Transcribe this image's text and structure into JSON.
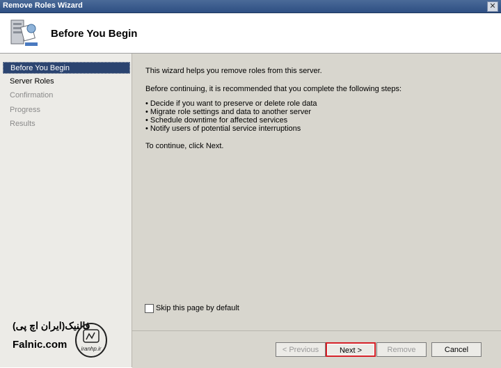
{
  "window": {
    "title": "Remove Roles Wizard",
    "close_glyph": "✕"
  },
  "header": {
    "title": "Before You Begin",
    "icon": "server-roles-icon"
  },
  "sidebar": {
    "items": [
      {
        "label": "Before You Begin",
        "state": "active"
      },
      {
        "label": "Server Roles",
        "state": "enabled"
      },
      {
        "label": "Confirmation",
        "state": "disabled"
      },
      {
        "label": "Progress",
        "state": "disabled"
      },
      {
        "label": "Results",
        "state": "disabled"
      }
    ]
  },
  "main": {
    "intro": "This wizard helps you remove roles from this server.",
    "before_text": "Before continuing, it is recommended that you complete the following steps:",
    "steps": [
      "Decide if you want to preserve or delete role data",
      "Migrate role settings and data to another server",
      "Schedule downtime for affected services",
      "Notify users of potential service interruptions"
    ],
    "continue_text": "To continue, click Next."
  },
  "skip": {
    "label": "Skip this page by default",
    "checked": false
  },
  "buttons": {
    "previous": "< Previous",
    "next": "Next >",
    "remove": "Remove",
    "cancel": "Cancel"
  },
  "watermark": {
    "persian": "فالنیک(ایران اچ پی)",
    "site": "Falnic.com",
    "seal_text": "iranhp.ir"
  },
  "colors": {
    "title_bar": "#2e4f83",
    "active_nav": "#2b4470",
    "panel": "#d8d6ce",
    "focus_outline": "#d42027"
  }
}
